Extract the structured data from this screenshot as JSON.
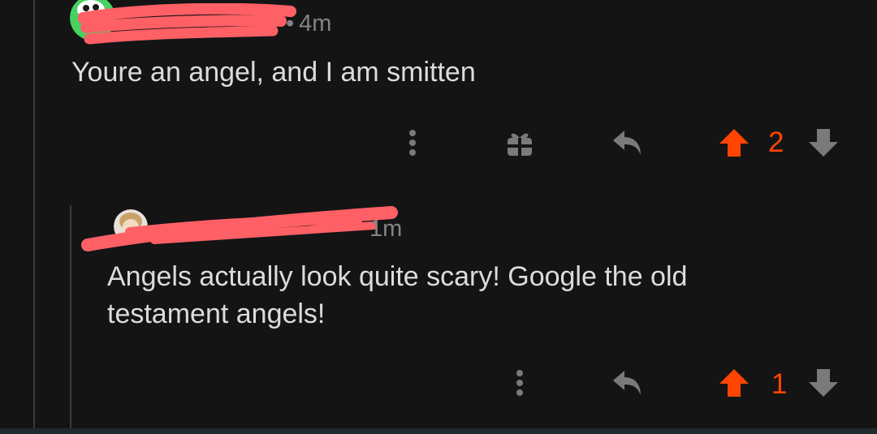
{
  "comments": [
    {
      "time_text": "4m",
      "time_prefix": "•",
      "body": "Youre an angel, and I am smitten",
      "vote_count": "2",
      "has_award": true
    },
    {
      "time_text": "1m",
      "body": "Angels actually look quite scary! Google the old\ntestament angels!",
      "vote_count": "1",
      "has_award": false
    }
  ],
  "colors": {
    "background": "#141415",
    "upvote_active": "#ff4500",
    "icon_gray": "#7a7a7c",
    "text": "#dcdcdd",
    "meta_text": "#838385",
    "redaction": "#ff6066"
  },
  "icons": {
    "more": "more-vertical-icon",
    "award": "gift-award-icon",
    "reply": "reply-arrow-icon",
    "upvote": "upvote-arrow-icon",
    "downvote": "downvote-arrow-icon"
  }
}
